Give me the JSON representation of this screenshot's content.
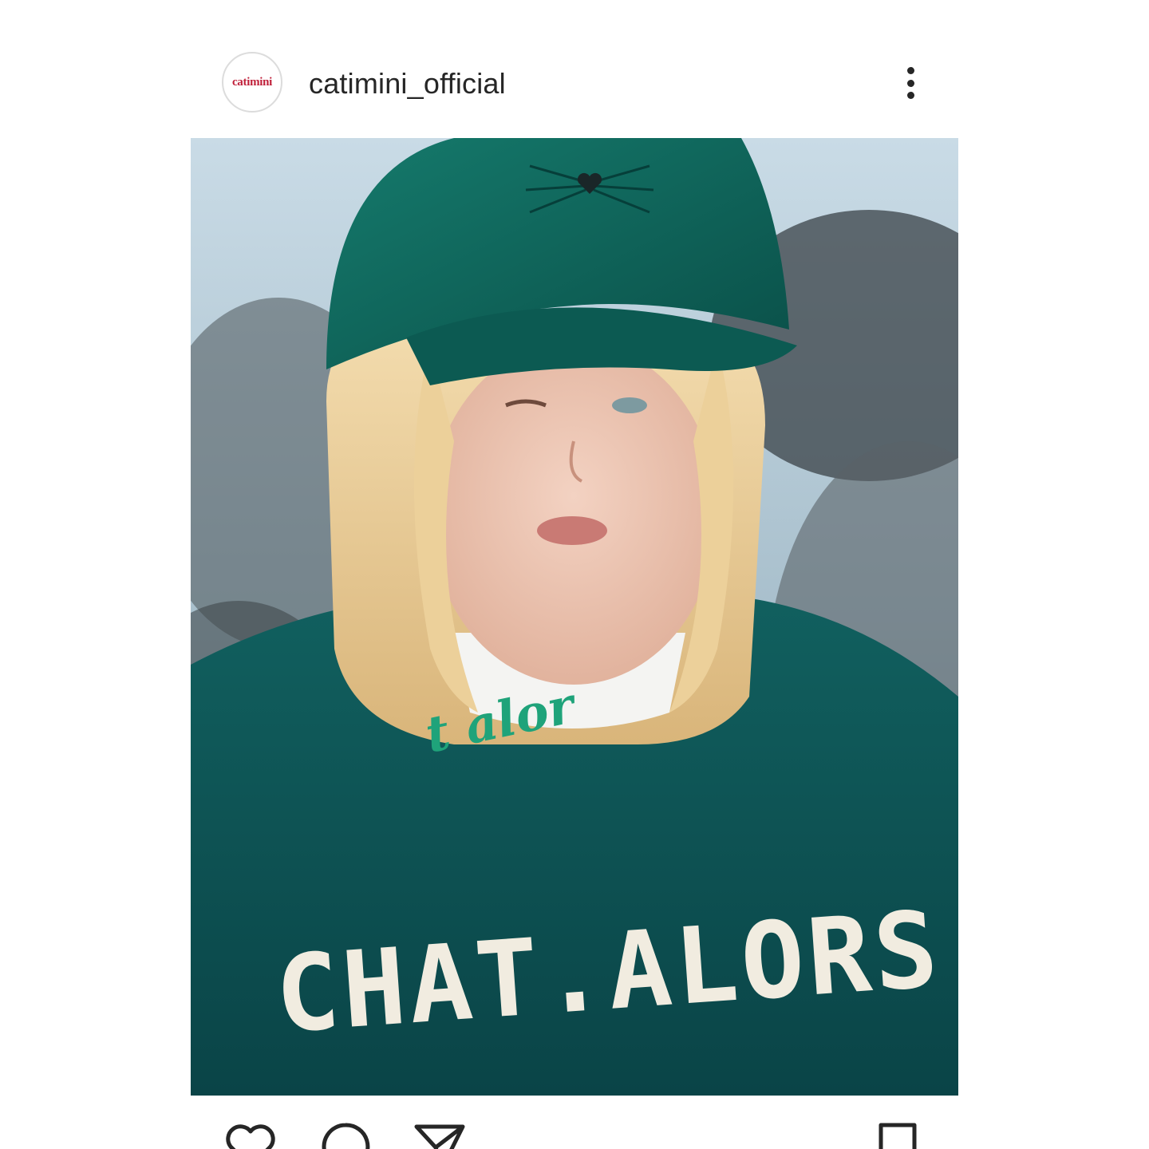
{
  "post": {
    "avatar_logo_text": "catimini",
    "username": "catimini_official",
    "more_icon": "more-vertical-icon",
    "image": {
      "description_icon": "photo",
      "sweater_text": "CHAT.ALORS",
      "collar_text": "t alor"
    },
    "actions": {
      "like_icon": "heart-icon",
      "comment_icon": "comment-icon",
      "share_icon": "paper-plane-icon",
      "save_icon": "bookmark-icon"
    }
  },
  "colors": {
    "text": "#262626",
    "brand_red": "#c0203a",
    "cap_green": "#0e5b54",
    "sweater_teal": "#0d4f52"
  }
}
